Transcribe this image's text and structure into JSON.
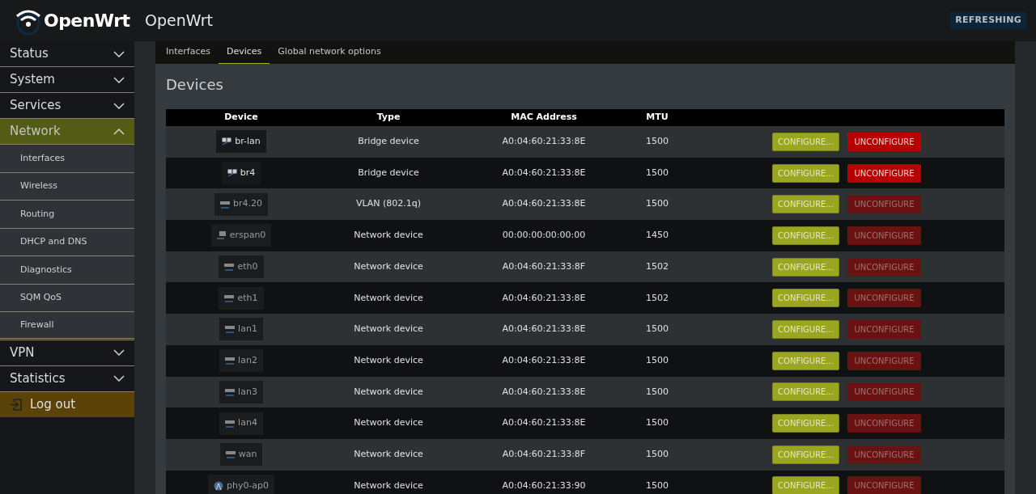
{
  "header": {
    "logo_text": "OpenWrt",
    "hostname": "OpenWrt",
    "indicator": "REFRESHING"
  },
  "sidebar": {
    "items": [
      {
        "label": "Status",
        "kind": "menu",
        "expanded": false,
        "selected": false
      },
      {
        "label": "System",
        "kind": "menu",
        "expanded": false,
        "selected": false
      },
      {
        "label": "Services",
        "kind": "menu",
        "expanded": false,
        "selected": false
      },
      {
        "label": "Network",
        "kind": "menu",
        "expanded": true,
        "selected": true,
        "children": [
          {
            "label": "Interfaces"
          },
          {
            "label": "Wireless"
          },
          {
            "label": "Routing"
          },
          {
            "label": "DHCP and DNS"
          },
          {
            "label": "Diagnostics"
          },
          {
            "label": "SQM QoS"
          },
          {
            "label": "Firewall"
          }
        ]
      },
      {
        "label": "VPN",
        "kind": "menu",
        "expanded": false,
        "selected": false
      },
      {
        "label": "Statistics",
        "kind": "menu",
        "expanded": false,
        "selected": false
      },
      {
        "label": "Log out",
        "kind": "logout"
      }
    ]
  },
  "tabs": [
    {
      "label": "Interfaces",
      "selected": false
    },
    {
      "label": "Devices",
      "selected": true
    },
    {
      "label": "Global network options",
      "selected": false
    }
  ],
  "section": {
    "title": "Devices"
  },
  "table": {
    "columns": [
      "Device",
      "Type",
      "MAC Address",
      "MTU"
    ],
    "rows": [
      {
        "device": "br-lan",
        "kind": "bridge",
        "configured": true,
        "type": "Bridge device",
        "mac": "A0:04:60:21:33:8E",
        "mtu": "1500",
        "configure": "CONFIGURE...",
        "unconfigure": "UNCONFIGURE"
      },
      {
        "device": "br4",
        "kind": "bridge",
        "configured": true,
        "type": "Bridge device",
        "mac": "A0:04:60:21:33:8E",
        "mtu": "1500",
        "configure": "CONFIGURE...",
        "unconfigure": "UNCONFIGURE"
      },
      {
        "device": "br4.20",
        "kind": "vlan",
        "configured": false,
        "type": "VLAN (802.1q)",
        "mac": "A0:04:60:21:33:8E",
        "mtu": "1500",
        "configure": "CONFIGURE...",
        "unconfigure": "UNCONFIGURE"
      },
      {
        "device": "erspan0",
        "kind": "tunnel",
        "configured": false,
        "type": "Network device",
        "mac": "00:00:00:00:00:00",
        "mtu": "1450",
        "configure": "CONFIGURE...",
        "unconfigure": "UNCONFIGURE"
      },
      {
        "device": "eth0",
        "kind": "ethernet",
        "configured": false,
        "type": "Network device",
        "mac": "A0:04:60:21:33:8F",
        "mtu": "1502",
        "configure": "CONFIGURE...",
        "unconfigure": "UNCONFIGURE"
      },
      {
        "device": "eth1",
        "kind": "ethernet",
        "configured": false,
        "type": "Network device",
        "mac": "A0:04:60:21:33:8E",
        "mtu": "1502",
        "configure": "CONFIGURE...",
        "unconfigure": "UNCONFIGURE"
      },
      {
        "device": "lan1",
        "kind": "ethernet",
        "configured": false,
        "type": "Network device",
        "mac": "A0:04:60:21:33:8E",
        "mtu": "1500",
        "configure": "CONFIGURE...",
        "unconfigure": "UNCONFIGURE"
      },
      {
        "device": "lan2",
        "kind": "ethernet",
        "configured": false,
        "type": "Network device",
        "mac": "A0:04:60:21:33:8E",
        "mtu": "1500",
        "configure": "CONFIGURE...",
        "unconfigure": "UNCONFIGURE"
      },
      {
        "device": "lan3",
        "kind": "ethernet",
        "configured": false,
        "type": "Network device",
        "mac": "A0:04:60:21:33:8E",
        "mtu": "1500",
        "configure": "CONFIGURE...",
        "unconfigure": "UNCONFIGURE"
      },
      {
        "device": "lan4",
        "kind": "ethernet",
        "configured": false,
        "type": "Network device",
        "mac": "A0:04:60:21:33:8E",
        "mtu": "1500",
        "configure": "CONFIGURE...",
        "unconfigure": "UNCONFIGURE"
      },
      {
        "device": "wan",
        "kind": "ethernet",
        "configured": false,
        "type": "Network device",
        "mac": "A0:04:60:21:33:8F",
        "mtu": "1500",
        "configure": "CONFIGURE...",
        "unconfigure": "UNCONFIGURE"
      },
      {
        "device": "phy0-ap0",
        "kind": "wifi",
        "configured": false,
        "type": "Network device",
        "mac": "A0:04:60:21:33:90",
        "mtu": "1500",
        "configure": "CONFIGURE...",
        "unconfigure": "UNCONFIGURE"
      }
    ]
  }
}
